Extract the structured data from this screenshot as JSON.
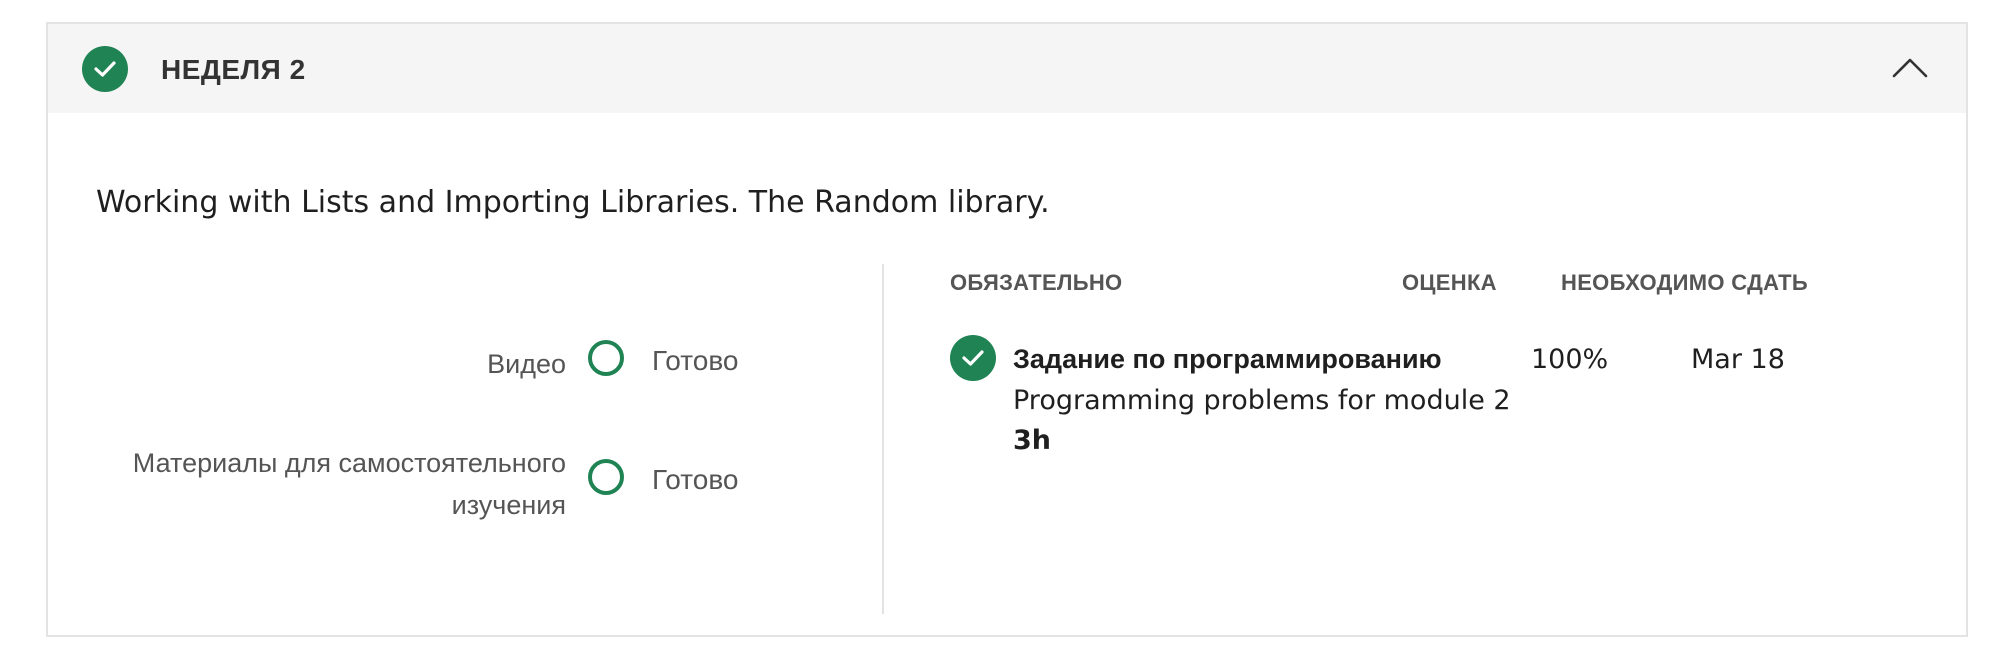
{
  "week": {
    "title": "НЕДЕЛЯ 2",
    "completed_icon": "check-circle-icon",
    "collapse_icon": "chevron-up-icon",
    "description": "Working with Lists and Importing Libraries. The Random library."
  },
  "progress": [
    {
      "label": "Видео",
      "status": "Готово"
    },
    {
      "label_line1": "Материалы для самостоятельного",
      "label_line2": "изучения",
      "status": "Готово"
    }
  ],
  "table": {
    "headers": {
      "required": "ОБЯЗАТЕЛЬНО",
      "grade": "ОЦЕНКА",
      "due": "НЕОБХОДИМО СДАТЬ"
    },
    "rows": [
      {
        "title": "Задание по программированию",
        "subtitle": "Programming problems for module 2",
        "duration": "3h",
        "grade": "100%",
        "due": "Mar 18",
        "status_icon": "check-circle-icon"
      }
    ]
  },
  "colors": {
    "accent": "#1f8354",
    "header_bg": "#f5f5f5",
    "border": "#e3e3e3"
  }
}
